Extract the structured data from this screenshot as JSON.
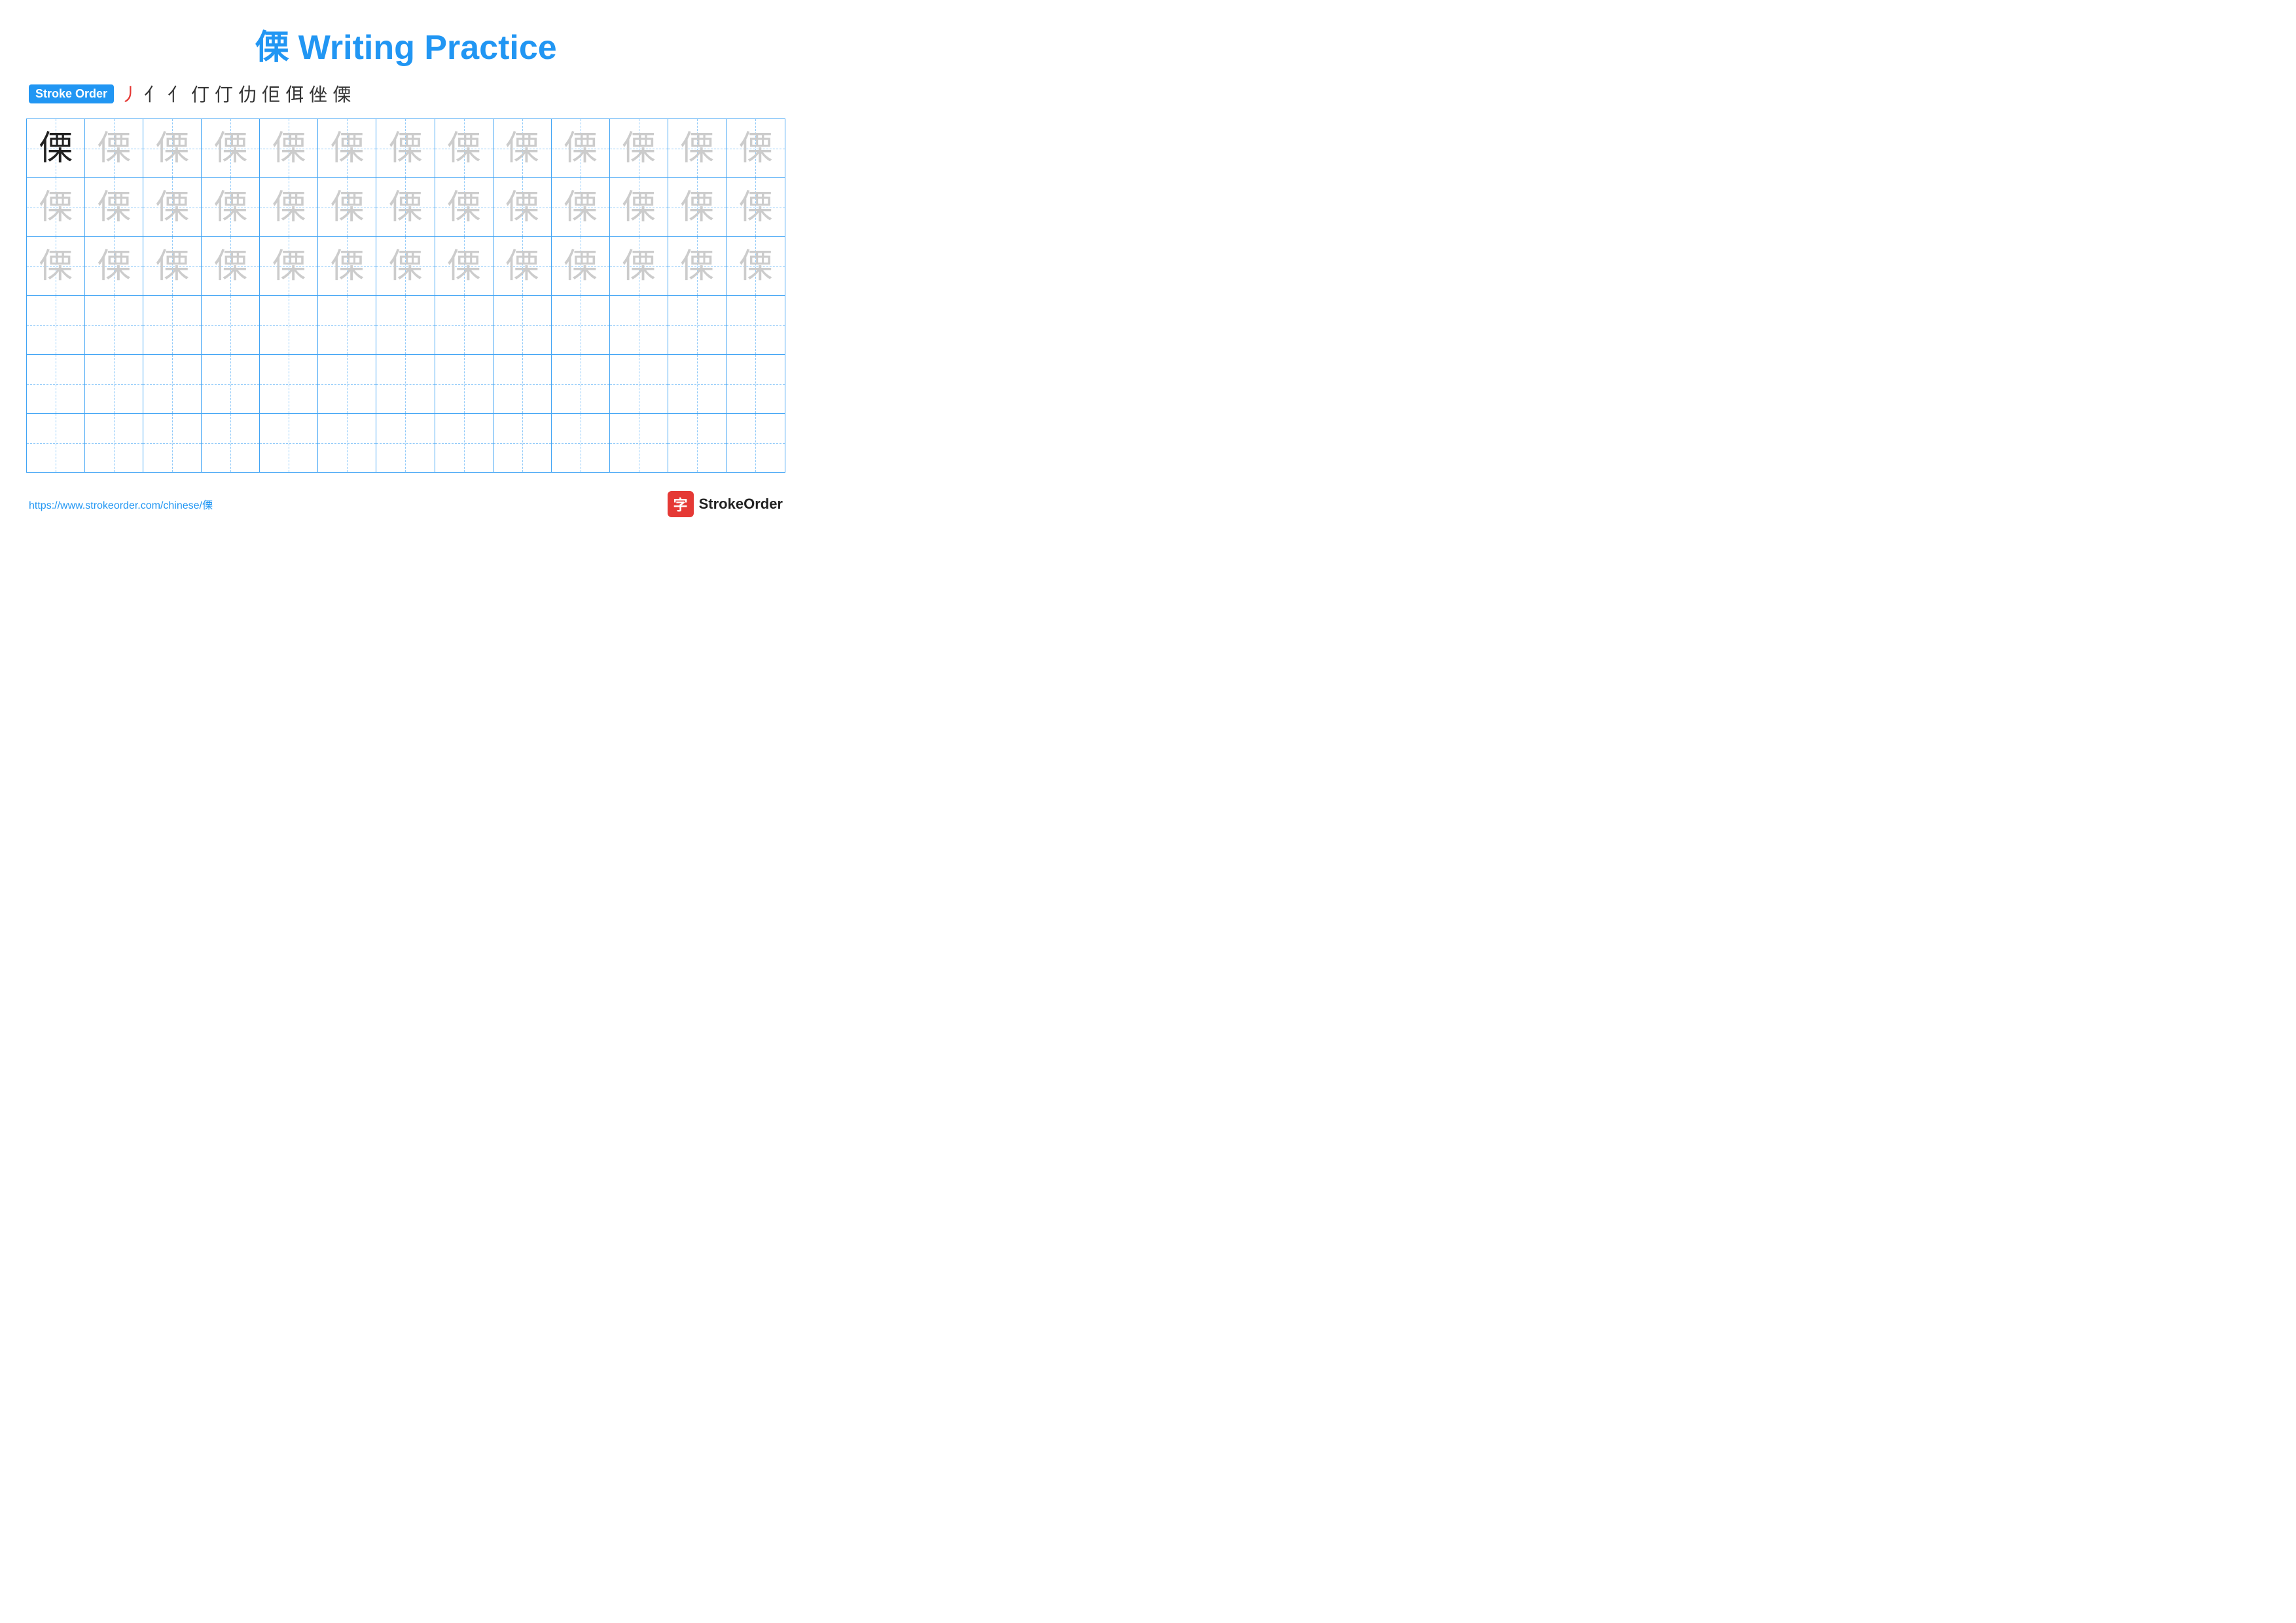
{
  "title": {
    "character": "傈",
    "label": "Writing Practice",
    "full": "傈 Writing Practice"
  },
  "stroke_order": {
    "badge_label": "Stroke Order",
    "strokes": [
      "丿",
      "亻",
      "亻",
      "仃",
      "仃",
      "仂",
      "佢",
      "佴",
      "侳",
      "傈"
    ],
    "red_index": 0
  },
  "grid": {
    "rows": 6,
    "cols": 13,
    "character": "傈",
    "filled_rows": [
      {
        "row_index": 0,
        "cells": [
          "dark",
          "light",
          "light",
          "light",
          "light",
          "light",
          "light",
          "light",
          "light",
          "light",
          "light",
          "light",
          "light"
        ]
      },
      {
        "row_index": 1,
        "cells": [
          "light",
          "light",
          "light",
          "light",
          "light",
          "light",
          "light",
          "light",
          "light",
          "light",
          "light",
          "light",
          "light"
        ]
      },
      {
        "row_index": 2,
        "cells": [
          "light",
          "light",
          "light",
          "light",
          "light",
          "light",
          "light",
          "light",
          "light",
          "light",
          "light",
          "light",
          "light"
        ]
      },
      {
        "row_index": 3,
        "cells": [
          "empty",
          "empty",
          "empty",
          "empty",
          "empty",
          "empty",
          "empty",
          "empty",
          "empty",
          "empty",
          "empty",
          "empty",
          "empty"
        ]
      },
      {
        "row_index": 4,
        "cells": [
          "empty",
          "empty",
          "empty",
          "empty",
          "empty",
          "empty",
          "empty",
          "empty",
          "empty",
          "empty",
          "empty",
          "empty",
          "empty"
        ]
      },
      {
        "row_index": 5,
        "cells": [
          "empty",
          "empty",
          "empty",
          "empty",
          "empty",
          "empty",
          "empty",
          "empty",
          "empty",
          "empty",
          "empty",
          "empty",
          "empty"
        ]
      }
    ]
  },
  "footer": {
    "url": "https://www.strokeorder.com/chinese/傈",
    "logo_icon": "字",
    "logo_text": "StrokeOrder"
  }
}
